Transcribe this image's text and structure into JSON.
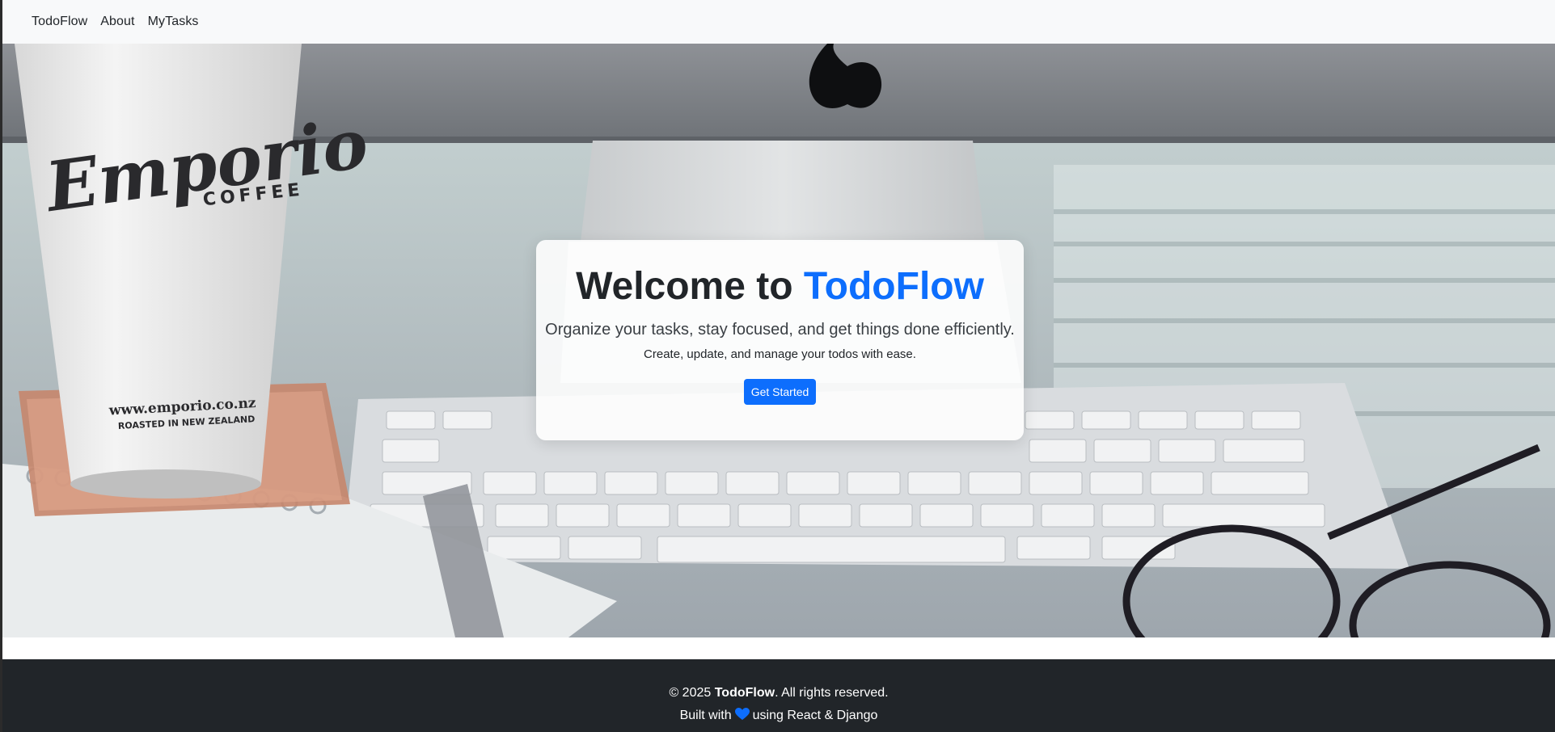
{
  "navbar": {
    "brand": "TodoFlow",
    "links": [
      "About",
      "MyTasks"
    ]
  },
  "hero": {
    "title_prefix": "Welcome to ",
    "title_brand": "TodoFlow",
    "lead": "Organize your tasks, stay focused, and get things done efficiently.",
    "sub": "Create, update, and manage your todos with ease.",
    "cta_label": "Get Started",
    "background_image": {
      "cup_brand": "Emporio",
      "cup_sub": "COFFEE",
      "cup_url": "www.emporio.co.nz",
      "cup_tagline": "ROASTED IN NEW ZEALAND"
    }
  },
  "footer": {
    "copyright_prefix": "© 2025 ",
    "copyright_brand": "TodoFlow",
    "copyright_suffix": ". All rights reserved.",
    "built_prefix": "Built with",
    "built_suffix": "using React & Django",
    "heart_icon": "heart-icon"
  },
  "colors": {
    "accent": "#0d6efd",
    "navbar_bg": "#f8f9fa",
    "footer_bg": "#212529",
    "heart": "#0d6efd"
  }
}
